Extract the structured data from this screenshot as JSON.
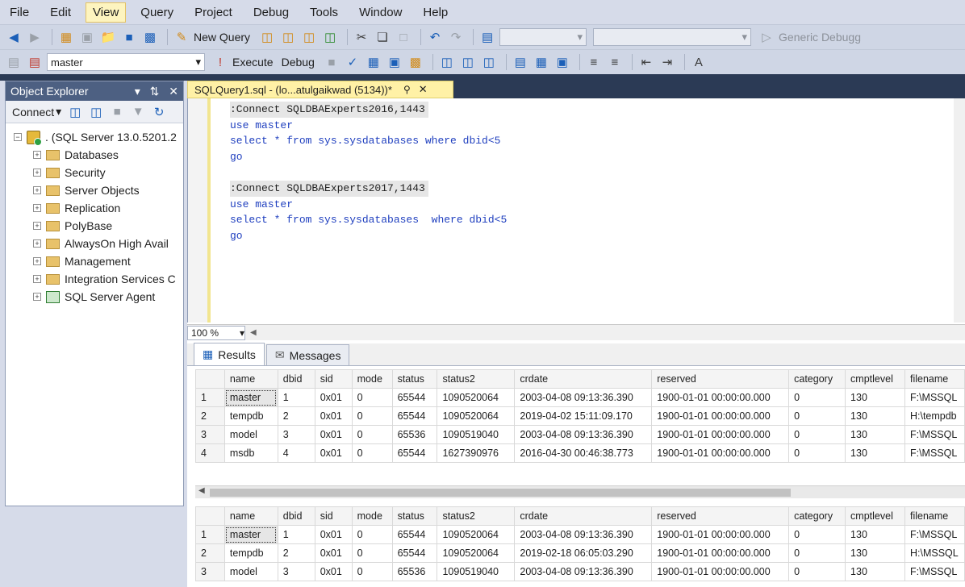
{
  "menu": [
    "File",
    "Edit",
    "View",
    "Query",
    "Project",
    "Debug",
    "Tools",
    "Window",
    "Help"
  ],
  "toolbar1": {
    "new_query": "New Query",
    "generic_debugger": "Generic Debugg"
  },
  "toolbar2": {
    "database": "master",
    "execute": "Execute",
    "debug": "Debug"
  },
  "object_explorer": {
    "title": "Object Explorer",
    "connect": "Connect",
    "server": ". (SQL Server 13.0.5201.2",
    "nodes": [
      "Databases",
      "Security",
      "Server Objects",
      "Replication",
      "PolyBase",
      "AlwaysOn High Avail",
      "Management",
      "Integration Services C"
    ],
    "agent": "SQL Server Agent"
  },
  "editor": {
    "tab_title": "SQLQuery1.sql - (lo...atulgaikwad (5134))*",
    "lines": [
      ":Connect SQLDBAExperts2016,1443",
      "use master",
      "select * from sys.sysdatabases where dbid<5",
      "go",
      "",
      ":Connect SQLDBAExperts2017,1443",
      "use master",
      "select * from sys.sysdatabases  where dbid<5",
      "go"
    ],
    "zoom": "100 %"
  },
  "results_tabs": [
    "Results",
    "Messages"
  ],
  "columns": [
    "",
    "name",
    "dbid",
    "sid",
    "mode",
    "status",
    "status2",
    "crdate",
    "reserved",
    "category",
    "cmptlevel",
    "filename"
  ],
  "grid1": [
    [
      "1",
      "master",
      "1",
      "0x01",
      "0",
      "65544",
      "1090520064",
      "2003-04-08 09:13:36.390",
      "1900-01-01 00:00:00.000",
      "0",
      "130",
      "F:\\MSSQL"
    ],
    [
      "2",
      "tempdb",
      "2",
      "0x01",
      "0",
      "65544",
      "1090520064",
      "2019-04-02 15:11:09.170",
      "1900-01-01 00:00:00.000",
      "0",
      "130",
      "H:\\tempdb"
    ],
    [
      "3",
      "model",
      "3",
      "0x01",
      "0",
      "65536",
      "1090519040",
      "2003-04-08 09:13:36.390",
      "1900-01-01 00:00:00.000",
      "0",
      "130",
      "F:\\MSSQL"
    ],
    [
      "4",
      "msdb",
      "4",
      "0x01",
      "0",
      "65544",
      "1627390976",
      "2016-04-30 00:46:38.773",
      "1900-01-01 00:00:00.000",
      "0",
      "130",
      "F:\\MSSQL"
    ]
  ],
  "grid2": [
    [
      "1",
      "master",
      "1",
      "0x01",
      "0",
      "65544",
      "1090520064",
      "2003-04-08 09:13:36.390",
      "1900-01-01 00:00:00.000",
      "0",
      "130",
      "F:\\MSSQL"
    ],
    [
      "2",
      "tempdb",
      "2",
      "0x01",
      "0",
      "65544",
      "1090520064",
      "2019-02-18 06:05:03.290",
      "1900-01-01 00:00:00.000",
      "0",
      "130",
      "H:\\MSSQL"
    ],
    [
      "3",
      "model",
      "3",
      "0x01",
      "0",
      "65536",
      "1090519040",
      "2003-04-08 09:13:36.390",
      "1900-01-01 00:00:00.000",
      "0",
      "130",
      "F:\\MSSQL"
    ]
  ]
}
